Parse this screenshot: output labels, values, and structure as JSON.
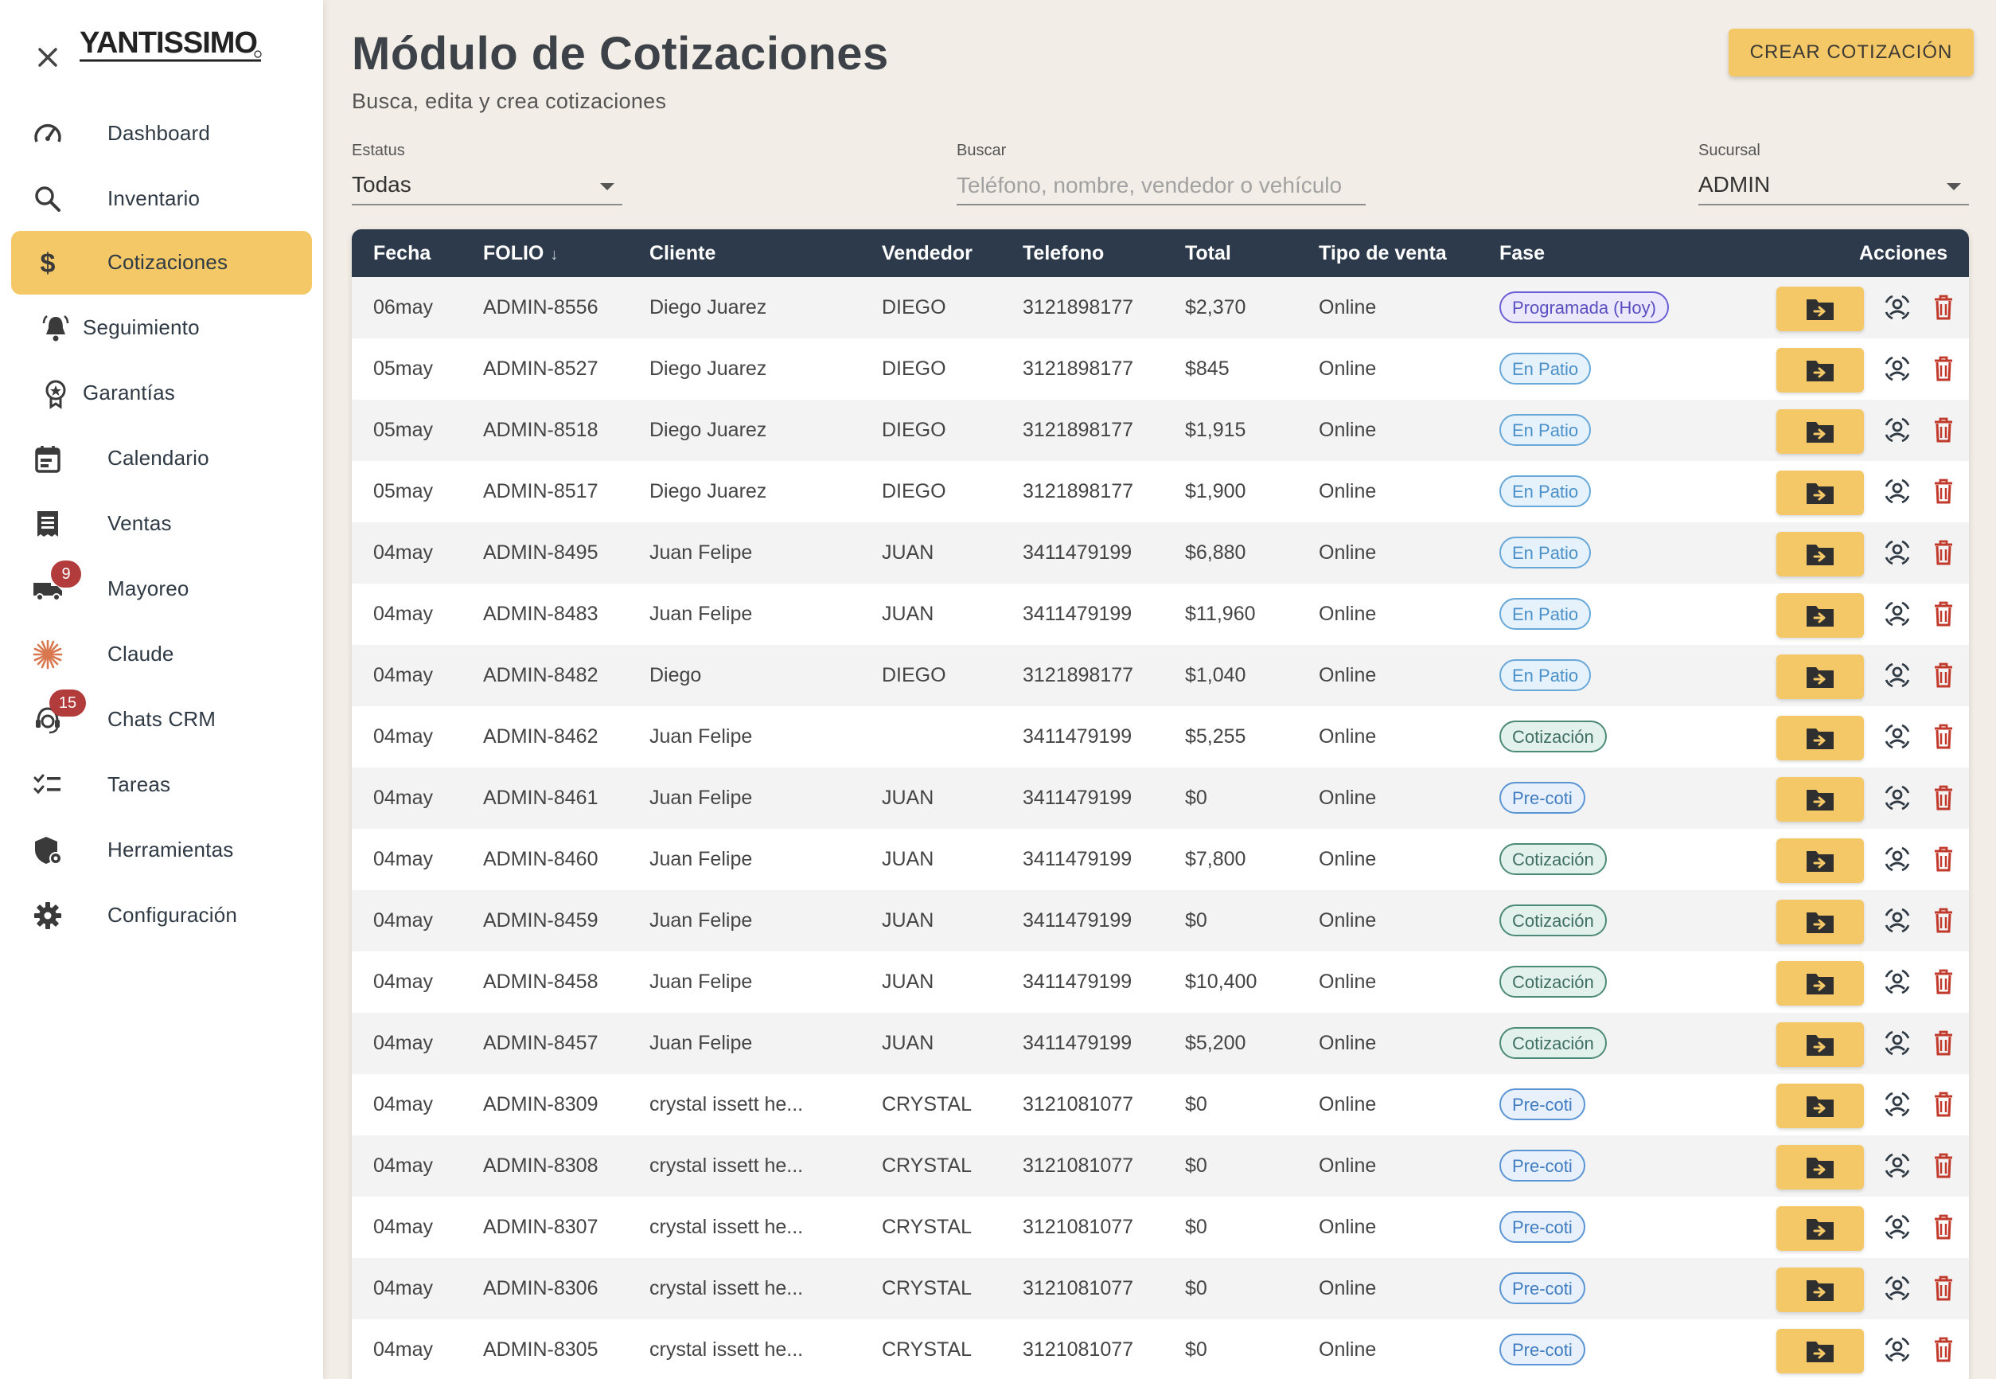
{
  "sidebar": {
    "logo_text": "YANTISSIMO",
    "items": [
      {
        "label": "Dashboard",
        "icon": "speedometer-icon",
        "active": false
      },
      {
        "label": "Inventario",
        "icon": "search-icon",
        "active": false
      },
      {
        "label": "Cotizaciones",
        "icon": "dollar-icon",
        "active": true
      },
      {
        "label": "Seguimiento",
        "icon": "bell-icon",
        "active": false
      },
      {
        "label": "Garantías",
        "icon": "award-icon",
        "active": false
      },
      {
        "label": "Calendario",
        "icon": "calendar-icon",
        "active": false
      },
      {
        "label": "Ventas",
        "icon": "receipt-icon",
        "active": false
      },
      {
        "label": "Mayoreo",
        "icon": "truck-icon",
        "active": false,
        "badge": "9"
      },
      {
        "label": "Claude",
        "icon": "claude-icon",
        "active": false
      },
      {
        "label": "Chats CRM",
        "icon": "support-agent-icon",
        "active": false,
        "badge": "15"
      },
      {
        "label": "Tareas",
        "icon": "checklist-icon",
        "active": false
      },
      {
        "label": "Herramientas",
        "icon": "shield-gear-icon",
        "active": false
      },
      {
        "label": "Configuración",
        "icon": "gear-icon",
        "active": false
      }
    ],
    "accent": "#f4c866"
  },
  "header": {
    "title": "Módulo de Cotizaciones",
    "subtitle": "Busca, edita y crea cotizaciones",
    "create_label": "CREAR COTIZACIÓN"
  },
  "filters": {
    "status_label": "Estatus",
    "status_value": "Todas",
    "search_label": "Buscar",
    "search_placeholder": "Teléfono, nombre, vendedor o vehículo",
    "search_value": "",
    "branch_label": "Sucursal",
    "branch_value": "ADMIN"
  },
  "table": {
    "columns": [
      "Fecha",
      "FOLIO",
      "Cliente",
      "Vendedor",
      "Telefono",
      "Total",
      "Tipo de venta",
      "Fase",
      "Acciones"
    ],
    "rows": [
      {
        "fecha": "06may",
        "folio": "ADMIN-8556",
        "cliente": "Diego Juarez",
        "vendedor": "DIEGO",
        "telefono": "3121898177",
        "total": "$2,370",
        "tipo": "Online",
        "fase": "Programada (Hoy)",
        "fase_type": "prog"
      },
      {
        "fecha": "05may",
        "folio": "ADMIN-8527",
        "cliente": "Diego Juarez",
        "vendedor": "DIEGO",
        "telefono": "3121898177",
        "total": "$845",
        "tipo": "Online",
        "fase": "En Patio",
        "fase_type": "patio"
      },
      {
        "fecha": "05may",
        "folio": "ADMIN-8518",
        "cliente": "Diego Juarez",
        "vendedor": "DIEGO",
        "telefono": "3121898177",
        "total": "$1,915",
        "tipo": "Online",
        "fase": "En Patio",
        "fase_type": "patio"
      },
      {
        "fecha": "05may",
        "folio": "ADMIN-8517",
        "cliente": "Diego Juarez",
        "vendedor": "DIEGO",
        "telefono": "3121898177",
        "total": "$1,900",
        "tipo": "Online",
        "fase": "En Patio",
        "fase_type": "patio"
      },
      {
        "fecha": "04may",
        "folio": "ADMIN-8495",
        "cliente": "Juan Felipe",
        "vendedor": "JUAN",
        "telefono": "3411479199",
        "total": "$6,880",
        "tipo": "Online",
        "fase": "En Patio",
        "fase_type": "patio"
      },
      {
        "fecha": "04may",
        "folio": "ADMIN-8483",
        "cliente": "Juan Felipe",
        "vendedor": "JUAN",
        "telefono": "3411479199",
        "total": "$11,960",
        "tipo": "Online",
        "fase": "En Patio",
        "fase_type": "patio"
      },
      {
        "fecha": "04may",
        "folio": "ADMIN-8482",
        "cliente": "Diego",
        "vendedor": "DIEGO",
        "telefono": "3121898177",
        "total": "$1,040",
        "tipo": "Online",
        "fase": "En Patio",
        "fase_type": "patio"
      },
      {
        "fecha": "04may",
        "folio": "ADMIN-8462",
        "cliente": "Juan Felipe",
        "vendedor": "",
        "telefono": "3411479199",
        "total": "$5,255",
        "tipo": "Online",
        "fase": "Cotización",
        "fase_type": "coti"
      },
      {
        "fecha": "04may",
        "folio": "ADMIN-8461",
        "cliente": "Juan Felipe",
        "vendedor": "JUAN",
        "telefono": "3411479199",
        "total": "$0",
        "tipo": "Online",
        "fase": "Pre-coti",
        "fase_type": "pre"
      },
      {
        "fecha": "04may",
        "folio": "ADMIN-8460",
        "cliente": "Juan Felipe",
        "vendedor": "JUAN",
        "telefono": "3411479199",
        "total": "$7,800",
        "tipo": "Online",
        "fase": "Cotización",
        "fase_type": "coti"
      },
      {
        "fecha": "04may",
        "folio": "ADMIN-8459",
        "cliente": "Juan Felipe",
        "vendedor": "JUAN",
        "telefono": "3411479199",
        "total": "$0",
        "tipo": "Online",
        "fase": "Cotización",
        "fase_type": "coti"
      },
      {
        "fecha": "04may",
        "folio": "ADMIN-8458",
        "cliente": "Juan Felipe",
        "vendedor": "JUAN",
        "telefono": "3411479199",
        "total": "$10,400",
        "tipo": "Online",
        "fase": "Cotización",
        "fase_type": "coti"
      },
      {
        "fecha": "04may",
        "folio": "ADMIN-8457",
        "cliente": "Juan Felipe",
        "vendedor": "JUAN",
        "telefono": "3411479199",
        "total": "$5,200",
        "tipo": "Online",
        "fase": "Cotización",
        "fase_type": "coti"
      },
      {
        "fecha": "04may",
        "folio": "ADMIN-8309",
        "cliente": "crystal issett he...",
        "vendedor": "CRYSTAL",
        "telefono": "3121081077",
        "total": "$0",
        "tipo": "Online",
        "fase": "Pre-coti",
        "fase_type": "pre"
      },
      {
        "fecha": "04may",
        "folio": "ADMIN-8308",
        "cliente": "crystal issett he...",
        "vendedor": "CRYSTAL",
        "telefono": "3121081077",
        "total": "$0",
        "tipo": "Online",
        "fase": "Pre-coti",
        "fase_type": "pre"
      },
      {
        "fecha": "04may",
        "folio": "ADMIN-8307",
        "cliente": "crystal issett he...",
        "vendedor": "CRYSTAL",
        "telefono": "3121081077",
        "total": "$0",
        "tipo": "Online",
        "fase": "Pre-coti",
        "fase_type": "pre"
      },
      {
        "fecha": "04may",
        "folio": "ADMIN-8306",
        "cliente": "crystal issett he...",
        "vendedor": "CRYSTAL",
        "telefono": "3121081077",
        "total": "$0",
        "tipo": "Online",
        "fase": "Pre-coti",
        "fase_type": "pre"
      },
      {
        "fecha": "04may",
        "folio": "ADMIN-8305",
        "cliente": "crystal issett he...",
        "vendedor": "CRYSTAL",
        "telefono": "3121081077",
        "total": "$0",
        "tipo": "Online",
        "fase": "Pre-coti",
        "fase_type": "pre"
      }
    ]
  },
  "colors": {
    "table_header": "#2c3a4b",
    "accent": "#f4c866",
    "danger": "#c0392b",
    "badge": "#b23b3b"
  }
}
